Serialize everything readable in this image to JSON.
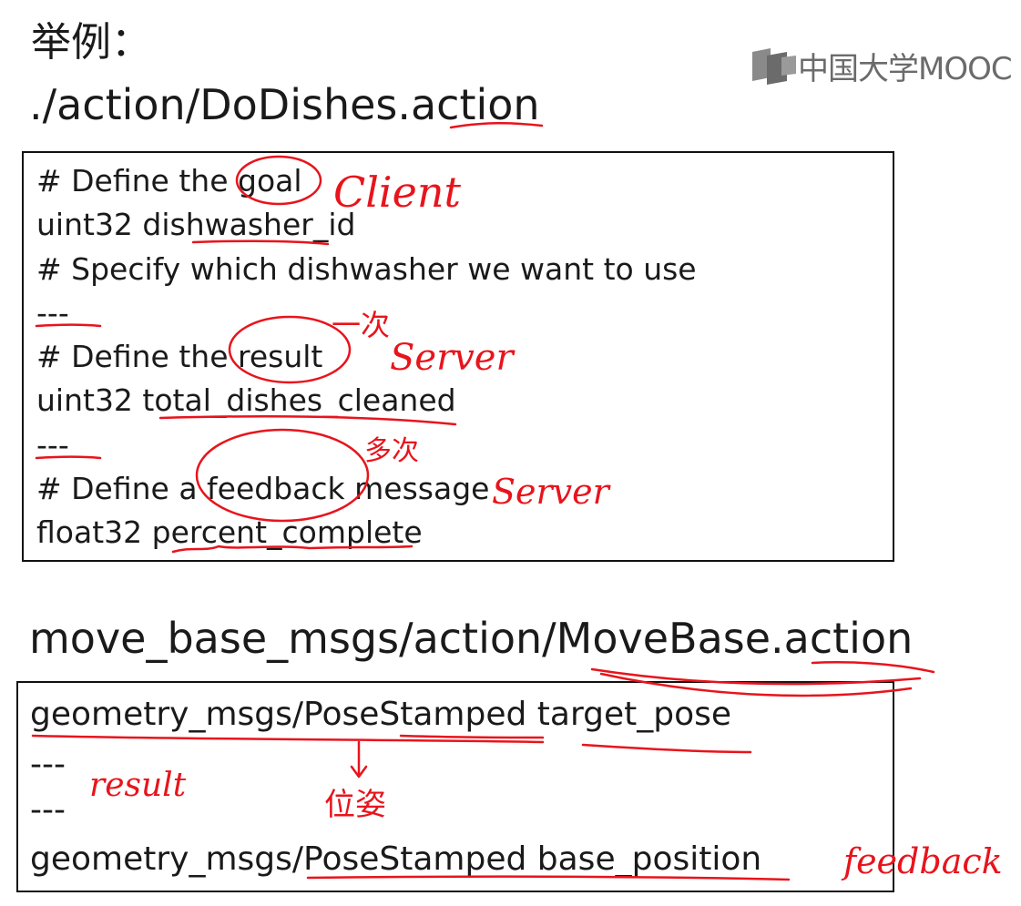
{
  "slide": {
    "heading": "举例：",
    "logo_text": "中国大学MOOC",
    "file1": "./action/DoDishes.action",
    "file2": "move_base_msgs/action/MoveBase.action"
  },
  "box1": {
    "lines": [
      "# Define the goal",
      "uint32 dishwasher_id",
      "# Specify which dishwasher we want to use",
      "---",
      "# Define the result",
      "uint32 total_dishes_cleaned",
      "---",
      "# Define a feedback message",
      "float32 percent_complete"
    ]
  },
  "box2": {
    "lines": [
      "geometry_msgs/PoseStamped target_pose",
      "---",
      "---",
      "geometry_msgs/PoseStamped base_position"
    ]
  },
  "annotations": {
    "client": "Client",
    "once": "一次",
    "server1": "Server",
    "many": "多次",
    "server2": "Server",
    "result": "result",
    "pose": "位姿",
    "feedback": "feedback"
  },
  "colors": {
    "ink": "#e8141c",
    "text": "#1a1a1a",
    "logo": "#6b6b6b"
  }
}
